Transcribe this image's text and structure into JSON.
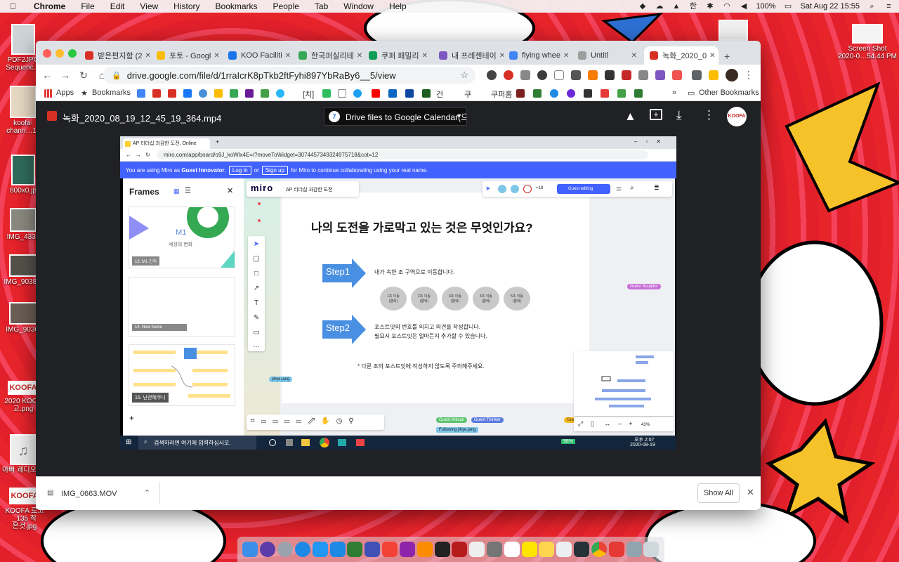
{
  "menubar": {
    "app": "Chrome",
    "items": [
      "File",
      "Edit",
      "View",
      "History",
      "Bookmarks",
      "People",
      "Tab",
      "Window",
      "Help"
    ],
    "battery": "100%",
    "clock": "Sat Aug 22  15:55"
  },
  "desktop": {
    "icons": [
      {
        "label": "PDF2JPG\nSequenc…"
      },
      {
        "label": "koofa-\nchann…11"
      },
      {
        "label": "800x0.jp"
      },
      {
        "label": "IMG_4332"
      },
      {
        "label": "IMG_9038.h"
      },
      {
        "label": "IMG_9036."
      },
      {
        "label": "2020 KOOF\n고.png"
      },
      {
        "label": "아빠 쾌디오.m"
      },
      {
        "label": "KOOFA 로고_135 작\n은것.jpg"
      }
    ],
    "screenshot_icon": "Screen Shot\n2020-0…54.44 PM",
    "koofa_logo": "KOOFA"
  },
  "tabs": [
    {
      "label": "받은편지함 (2",
      "color": "#d93025"
    },
    {
      "label": "포토 - Googl",
      "color": "#fbbc04"
    },
    {
      "label": "KOO Faciliti",
      "color": "#1a73e8"
    },
    {
      "label": "한국퍼실리테",
      "color": "#34a853"
    },
    {
      "label": "쿠퍼 패밀리",
      "color": "#0f9d58"
    },
    {
      "label": "내 프레젠테이",
      "color": "#7e57c2"
    },
    {
      "label": "flying whee",
      "color": "#4285f4"
    },
    {
      "label": "Untitl",
      "color": "#9e9e9e"
    },
    {
      "label": "녹화_2020_0",
      "color": "#d93025"
    }
  ],
  "address": {
    "url": "drive.google.com/file/d/1rraIcrK8pTkb2ftFyhi897YbRaBy6__5/view"
  },
  "bookmarks": {
    "apps": "Apps",
    "bookmarks": "Bookmarks",
    "chi": "[치]",
    "geon": "건",
    "ku": "쿠",
    "kuphome": "쿠퍼홈",
    "other": "Other Bookmarks"
  },
  "drive": {
    "filename": "녹화_2020_08_19_12_45_19_364.mp4",
    "open_with": "Drive files to Google Calendar(으...",
    "avatar": "KOOFA"
  },
  "video": {
    "tab_title": "AP 리더십 과감한 도전, Online",
    "url": "miro.com/app/board/o9J_koWlx4E=/?moveToWidget=3074457349324975718&cot=12",
    "banner": {
      "pre": "You are using Miro as",
      "role": "Guest Innovator",
      "dot": ".",
      "login": "Log in",
      "or": "or",
      "signup": "Sign up",
      "post": "for Miro to continue collaborating using your real name."
    },
    "frames": {
      "title": "Frames",
      "f13_big": "M1",
      "f13_sub": "세상의 변화",
      "f13_label": "13. M1 간지",
      "f14_label": "14. New frame",
      "f15_label": "15. 난관해쿠니",
      "add": "+"
    },
    "board": {
      "logo": "miro",
      "board_name": "AP 리더십 과감한 도전",
      "count": "+18",
      "guest_editing": "Guest editing",
      "question": "나의 도전을 가로막고 있는 것은 무엇인가요?",
      "step1": "Step1",
      "step1_text": "내가 속한 조 구역으로 이동합니다.",
      "pills": [
        "1조 이동\n(클릭)",
        "2조 이동\n(클릭)",
        "3조 이동\n(클릭)",
        "4조 이동\n(클릭)",
        "5조 이동\n(클릭)"
      ],
      "step2": "Step2",
      "step2_line1": "포스트잇의 번호를 외치고 의견을 작성합니다.",
      "step2_line2": "필요시 포스트잇은 얼마든지 추가할 수 있습니다.",
      "note": "* 다른 조의 포스트잇에 작성하지 않도록 주의해주세요.",
      "guest_sculptor": "Guest Sculptor",
      "jihye": "jihye.jang",
      "guest_artisan": "Guest Artisan",
      "guest_thinker": "Guest Thinker",
      "following": "Following jihye.jang",
      "zoom": "43%",
      "gue": "Gue"
    },
    "taskbar": {
      "search": "검색하려면 여기에 입력하십시오.",
      "battery": "98%",
      "time": "오후 2:07",
      "date": "2020-08-19"
    }
  },
  "download": {
    "file": "IMG_0663.MOV",
    "show_all": "Show All"
  }
}
